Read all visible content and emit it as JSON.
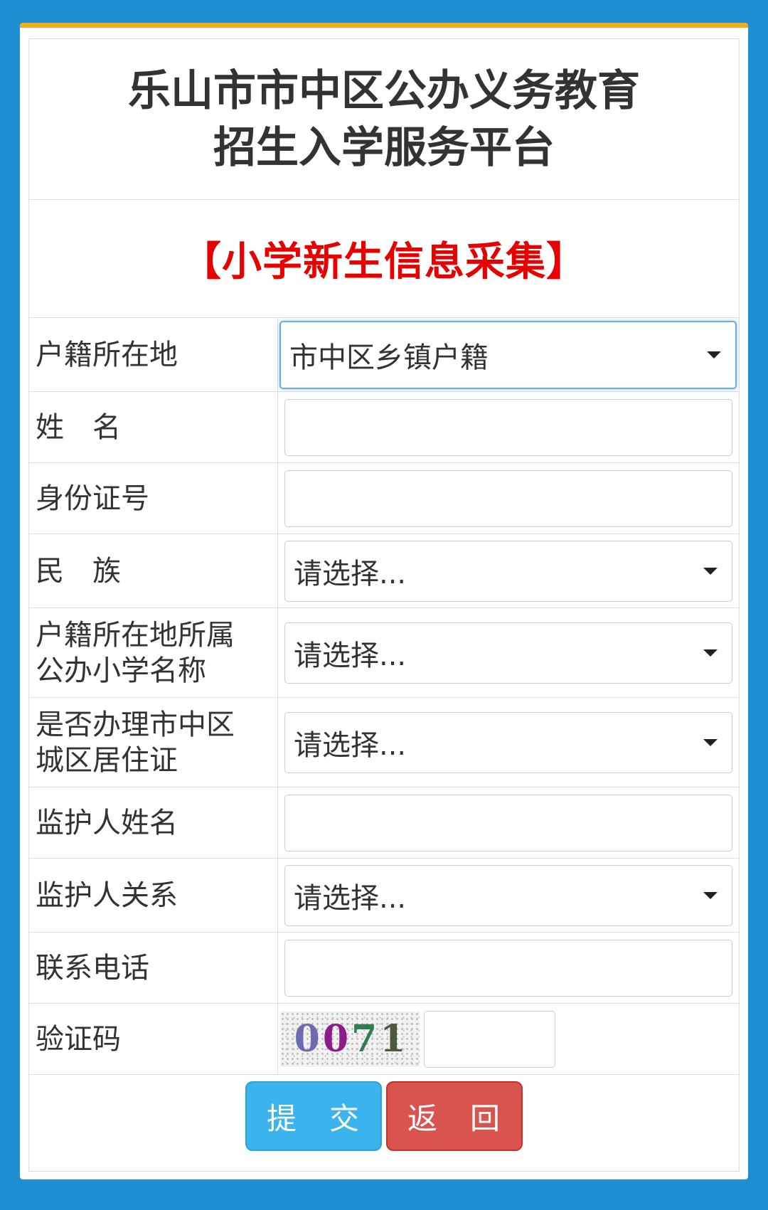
{
  "header": {
    "title_line1": "乐山市市中区公办义务教育",
    "title_line2": "招生入学服务平台",
    "subtitle": "【小学新生信息采集】"
  },
  "form": {
    "household_location": {
      "label": "户籍所在地",
      "value": "市中区乡镇户籍"
    },
    "name": {
      "label": "姓　名",
      "value": ""
    },
    "id_number": {
      "label": "身份证号",
      "value": ""
    },
    "ethnicity": {
      "label": "民　族",
      "value": "请选择..."
    },
    "school": {
      "label": "户籍所在地所属\n公办小学名称",
      "value": "请选择..."
    },
    "residence_permit": {
      "label": "是否办理市中区\n城区居住证",
      "value": "请选择..."
    },
    "guardian_name": {
      "label": "监护人姓名",
      "value": ""
    },
    "guardian_relation": {
      "label": "监护人关系",
      "value": "请选择..."
    },
    "phone": {
      "label": "联系电话",
      "value": ""
    },
    "captcha": {
      "label": "验证码",
      "digits": [
        "0",
        "0",
        "7",
        "1"
      ],
      "digit_colors": [
        "#6b6bb0",
        "#8b1c8b",
        "#2e7d4f",
        "#4a5a3a"
      ],
      "value": ""
    }
  },
  "actions": {
    "submit_label": "提　交",
    "back_label": "返　回"
  },
  "colors": {
    "background": "#1e90d2",
    "accent_border": "#f0ad1c",
    "subtitle": "#e60000",
    "submit": "#3bb3ec",
    "back": "#d9534f"
  }
}
